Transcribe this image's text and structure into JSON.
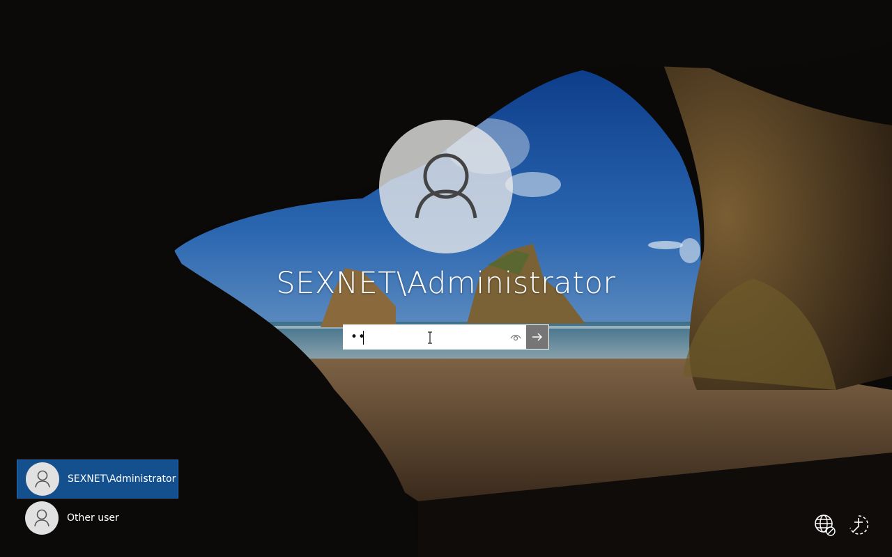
{
  "lockscreen": {
    "account_name": "SEXNET\\Administrator",
    "password": {
      "masked_value": "••",
      "reveal_icon": "eye-icon",
      "submit_icon": "arrow-right-icon"
    }
  },
  "user_switcher": {
    "users": [
      {
        "label": "SEXNET\\Administrator",
        "selected": true
      },
      {
        "label": "Other user",
        "selected": false
      }
    ]
  },
  "system_buttons": {
    "network_icon": "network-globe-icon",
    "accessibility_icon": "ease-of-access-icon"
  },
  "colors": {
    "selected_user_bg": "#14508e",
    "submit_bg": "#767676"
  }
}
